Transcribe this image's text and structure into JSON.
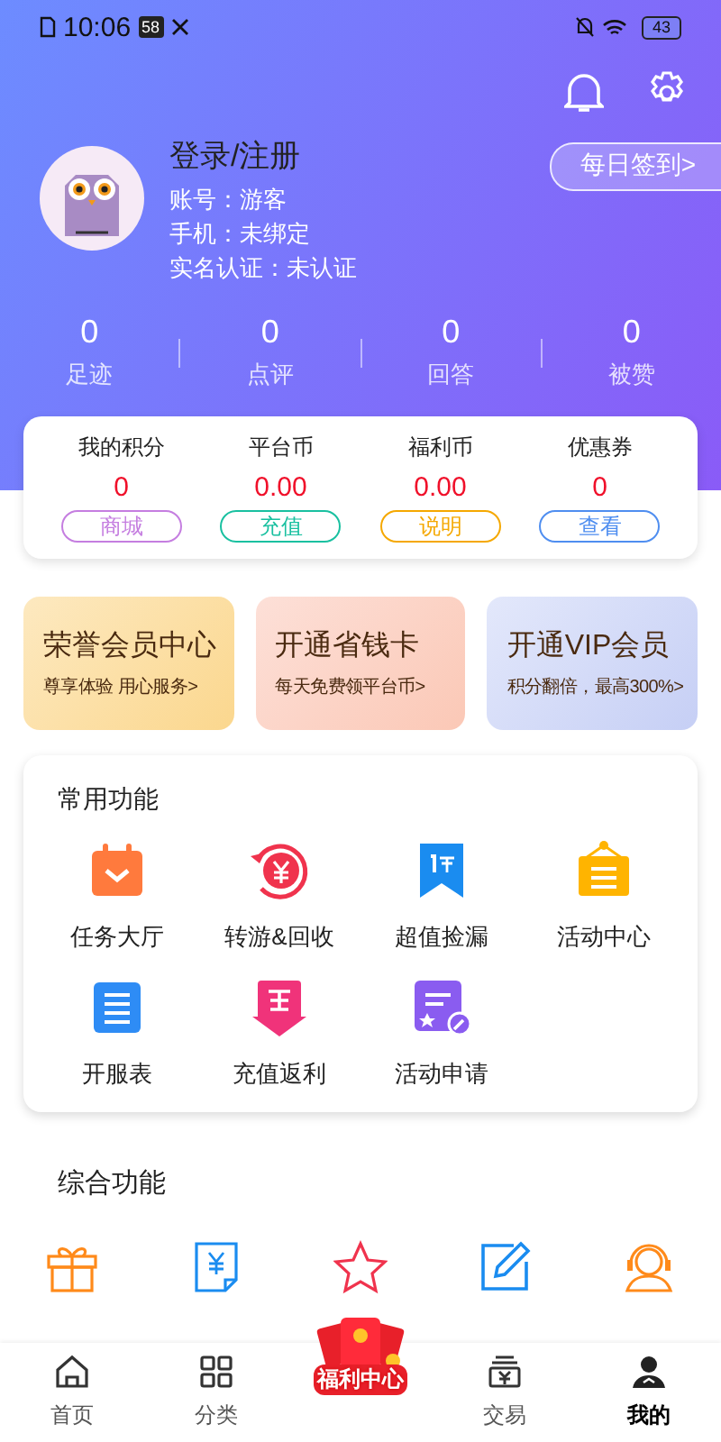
{
  "status_bar": {
    "time": "10:06",
    "badge": "58",
    "battery": "43"
  },
  "profile": {
    "title": "登录/注册",
    "lines": [
      "账号：游客",
      "手机：未绑定",
      "实名认证：未认证"
    ],
    "checkin": "每日签到>"
  },
  "stats": [
    {
      "value": "0",
      "label": "足迹"
    },
    {
      "value": "0",
      "label": "点评"
    },
    {
      "value": "0",
      "label": "回答"
    },
    {
      "value": "0",
      "label": "被赞"
    }
  ],
  "wallet": [
    {
      "label": "我的积分",
      "value": "0",
      "action": "商城",
      "color": "#c57ee0"
    },
    {
      "label": "平台币",
      "value": "0.00",
      "action": "充值",
      "color": "#19c0a0"
    },
    {
      "label": "福利币",
      "value": "0.00",
      "action": "说明",
      "color": "#f5a800"
    },
    {
      "label": "优惠券",
      "value": "0",
      "action": "查看",
      "color": "#4f8ef0"
    }
  ],
  "promos": [
    {
      "title": "荣誉会员中心",
      "subtitle": "尊享体验 用心服务>",
      "kind": "gold"
    },
    {
      "title": "开通省钱卡",
      "subtitle": "每天免费领平台币>",
      "kind": "peach"
    },
    {
      "title": "开通VIP会员",
      "subtitle": "积分翻倍，最高300%>",
      "kind": "blue"
    }
  ],
  "common": {
    "title": "常用功能",
    "items": [
      {
        "label": "任务大厅",
        "kind": "calendar"
      },
      {
        "label": "转游&回收",
        "kind": "yuan-cycle"
      },
      {
        "label": "超值捡漏",
        "kind": "discount"
      },
      {
        "label": "活动中心",
        "kind": "board"
      },
      {
        "label": "开服表",
        "kind": "list"
      },
      {
        "label": "充值返利",
        "kind": "rebate"
      },
      {
        "label": "活动申请",
        "kind": "apply"
      }
    ]
  },
  "general": {
    "title": "综合功能",
    "items": [
      {
        "kind": "gift"
      },
      {
        "kind": "bill"
      },
      {
        "kind": "star"
      },
      {
        "kind": "edit"
      },
      {
        "kind": "headset"
      }
    ]
  },
  "tabs": [
    {
      "label": "首页",
      "kind": "home",
      "selected": false
    },
    {
      "label": "分类",
      "kind": "grid",
      "selected": false
    },
    {
      "label": "福利中心",
      "kind": "packet",
      "selected": false
    },
    {
      "label": "交易",
      "kind": "trade",
      "selected": false
    },
    {
      "label": "我的",
      "kind": "user",
      "selected": true
    }
  ]
}
